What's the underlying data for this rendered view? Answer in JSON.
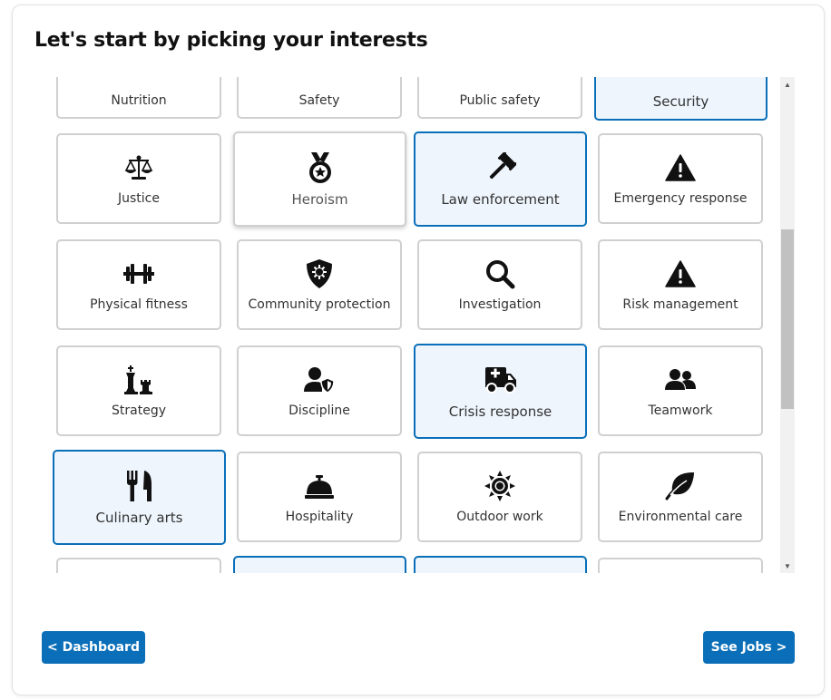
{
  "title": "Let's start by picking your interests",
  "tiles": [
    {
      "label": "Nutrition",
      "icon": "",
      "selected": false
    },
    {
      "label": "Safety",
      "icon": "",
      "selected": false
    },
    {
      "label": "Public safety",
      "icon": "",
      "selected": false
    },
    {
      "label": "Security",
      "icon": "",
      "selected": true
    },
    {
      "label": "Justice",
      "icon": "scales-icon",
      "selected": false
    },
    {
      "label": "Heroism",
      "icon": "medal-icon",
      "selected": false
    },
    {
      "label": "Law enforcement",
      "icon": "gavel-icon",
      "selected": true
    },
    {
      "label": "Emergency response",
      "icon": "warning-icon",
      "selected": false
    },
    {
      "label": "Physical fitness",
      "icon": "dumbbell-icon",
      "selected": false
    },
    {
      "label": "Community protection",
      "icon": "shield-virus-icon",
      "selected": false
    },
    {
      "label": "Investigation",
      "icon": "magnifier-icon",
      "selected": false
    },
    {
      "label": "Risk management",
      "icon": "warning-icon",
      "selected": false
    },
    {
      "label": "Strategy",
      "icon": "chess-icon",
      "selected": false
    },
    {
      "label": "Discipline",
      "icon": "user-shield-icon",
      "selected": false
    },
    {
      "label": "Crisis response",
      "icon": "ambulance-icon",
      "selected": true
    },
    {
      "label": "Teamwork",
      "icon": "users-icon",
      "selected": false
    },
    {
      "label": "Culinary arts",
      "icon": "utensils-icon",
      "selected": true
    },
    {
      "label": "Hospitality",
      "icon": "concierge-bell-icon",
      "selected": false
    },
    {
      "label": "Outdoor work",
      "icon": "sun-icon",
      "selected": false
    },
    {
      "label": "Environmental care",
      "icon": "leaf-icon",
      "selected": false
    },
    {
      "label": "",
      "icon": "",
      "selected": false
    },
    {
      "label": "",
      "icon": "",
      "selected": true
    },
    {
      "label": "",
      "icon": "",
      "selected": true
    },
    {
      "label": "",
      "icon": "",
      "selected": false
    }
  ],
  "buttons": {
    "dashboard": "< Dashboard",
    "see_jobs": "See Jobs >"
  },
  "colors": {
    "accent": "#0a6fb8",
    "selected_bg": "#eef5fd",
    "border": "#d0d0d0"
  }
}
